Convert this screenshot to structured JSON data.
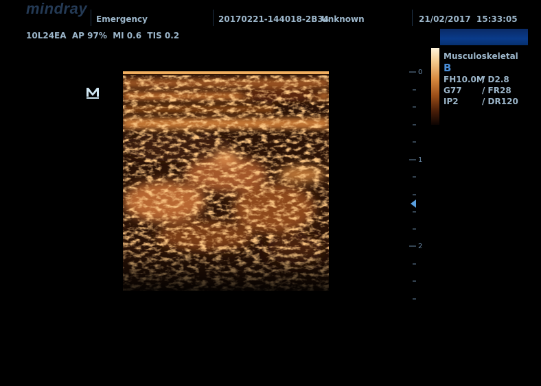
{
  "header": {
    "logo": "mindray",
    "exam": "Emergency",
    "patient_id": "20170221-144018-2B34",
    "patient_name": "Unknown",
    "datetime": "21/02/2017  15:33:05",
    "probe_info": "10L24EA  AP 97%  MI 0.6  TIS 0.2"
  },
  "params": {
    "preset": "Musculoskeletal",
    "mode": "B",
    "rows": [
      {
        "left": "FH10.0M",
        "right": "/ D2.8"
      },
      {
        "left": "G77",
        "right": "/ FR28"
      },
      {
        "left": "IP2",
        "right": "/ DR120"
      }
    ]
  },
  "depth_scale": {
    "labels": [
      "0",
      "1",
      "2"
    ]
  },
  "colors": {
    "text": "#9cb6ca",
    "mode_text": "#4a8ed8",
    "scale": "#6a8aa8",
    "image_hot": "#f0a050"
  },
  "icons": {
    "orientation_marker": "M-icon",
    "focus_marker": "focus-triangle-icon"
  }
}
